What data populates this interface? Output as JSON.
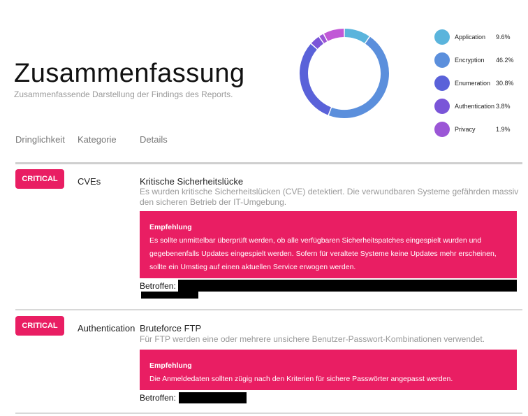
{
  "header": {
    "title": "Zusammenfassung",
    "subtitle": "Zusammenfassende Darstellung der Findings des Reports."
  },
  "chart_data": {
    "type": "pie",
    "variant": "donut",
    "title": "",
    "legend_position": "right",
    "slices": [
      {
        "label": "Application",
        "value": 9.6,
        "display": "9.6%",
        "color": "#5ab4dc"
      },
      {
        "label": "Encryption",
        "value": 46.2,
        "display": "46.2%",
        "color": "#5b8fdc"
      },
      {
        "label": "Enumeration",
        "value": 30.8,
        "display": "30.8%",
        "color": "#5a62d9"
      },
      {
        "label": "Authentication",
        "value": 3.8,
        "display": "3.8%",
        "color": "#7a55d8"
      },
      {
        "label": "Privacy",
        "value": 1.9,
        "display": "1.9%",
        "color": "#9b56d6"
      },
      {
        "label": "",
        "value": 7.7,
        "display": "",
        "color": "#c158d6"
      }
    ]
  },
  "table": {
    "headers": [
      "Dringlichkeit",
      "Kategorie",
      "Details"
    ],
    "rows": [
      {
        "severity": "CRITICAL",
        "category": "CVEs",
        "title": "Kritische Sicherheitslücke",
        "description": "Es wurden kritische Sicherheitslücken (CVE) detektiert. Die verwundbaren Systeme gefährden massiv den sicheren Betrieb der IT-Umgebung.",
        "recommendation_title": "Empfehlung",
        "recommendation": "Es sollte unmittelbar überprüft werden, ob alle verfügbaren Sicherheitspatches eingespielt wurden und gegebenenfalls Updates eingespielt werden. Sofern für veraltete Systeme keine Updates mehr erscheinen, sollte ein Umstieg auf einen aktuellen Service erwogen werden.",
        "affected_label": "Betroffen:"
      },
      {
        "severity": "CRITICAL",
        "category": "Authentication",
        "title": "Bruteforce FTP",
        "description": "Für FTP werden eine oder mehrere unsichere Benutzer-Passwort-Kombinationen verwendet.",
        "recommendation_title": "Empfehlung",
        "recommendation": "Die Anmeldedaten sollten zügig nach den Kriterien für sichere Passwörter angepasst werden.",
        "affected_label": "Betroffen:"
      }
    ]
  },
  "colors": {
    "accent": "#e91e63"
  }
}
